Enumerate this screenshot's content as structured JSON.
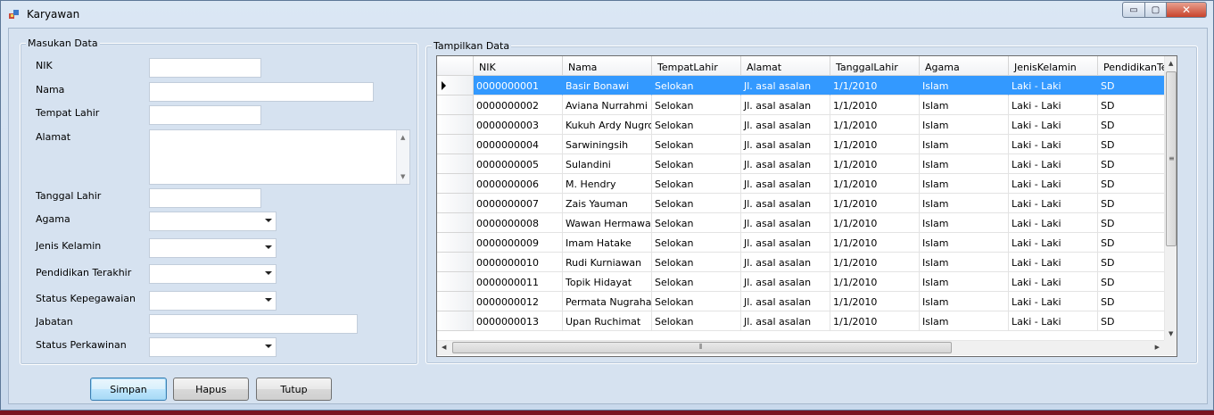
{
  "window": {
    "title": "Karyawan",
    "controls": {
      "minimize": "▭",
      "maximize": "▢",
      "close": "✕"
    }
  },
  "input_group": {
    "title": "Masukan Data",
    "fields": {
      "nik": {
        "label": "NIK",
        "value": ""
      },
      "nama": {
        "label": "Nama",
        "value": ""
      },
      "tempat_lahir": {
        "label": "Tempat Lahir",
        "value": ""
      },
      "alamat": {
        "label": "Alamat",
        "value": ""
      },
      "tanggal_lahir": {
        "label": "Tanggal Lahir",
        "value": ""
      },
      "agama": {
        "label": "Agama",
        "value": ""
      },
      "jenis_kelamin": {
        "label": "Jenis Kelamin",
        "value": ""
      },
      "pendidikan": {
        "label": "Pendidikan Terakhir",
        "value": ""
      },
      "status_kepegawaian": {
        "label": "Status Kepegawaian",
        "value": ""
      },
      "jabatan": {
        "label": "Jabatan",
        "value": ""
      },
      "status_perkawinan": {
        "label": "Status Perkawinan",
        "value": ""
      }
    }
  },
  "buttons": {
    "save": "Simpan",
    "delete": "Hapus",
    "close": "Tutup"
  },
  "display_group": {
    "title": "Tampilkan Data",
    "columns": [
      "NIK",
      "Nama",
      "TempatLahir",
      "Alamat",
      "TanggalLahir",
      "Agama",
      "JenisKelamin",
      "PendidikanTerakhir"
    ],
    "rows": [
      [
        "0000000001",
        "Basir Bonawi",
        "Selokan",
        "Jl. asal asalan",
        "1/1/2010",
        "Islam",
        "Laki - Laki",
        "SD"
      ],
      [
        "0000000002",
        "Aviana Nurrahmi",
        "Selokan",
        "Jl. asal asalan",
        "1/1/2010",
        "Islam",
        "Laki - Laki",
        "SD"
      ],
      [
        "0000000003",
        "Kukuh Ardy Nugroho",
        "Selokan",
        "Jl. asal asalan",
        "1/1/2010",
        "Islam",
        "Laki - Laki",
        "SD"
      ],
      [
        "0000000004",
        "Sarwiningsih",
        "Selokan",
        "Jl. asal asalan",
        "1/1/2010",
        "Islam",
        "Laki - Laki",
        "SD"
      ],
      [
        "0000000005",
        "Sulandini",
        "Selokan",
        "Jl. asal asalan",
        "1/1/2010",
        "Islam",
        "Laki - Laki",
        "SD"
      ],
      [
        "0000000006",
        "M. Hendry",
        "Selokan",
        "Jl. asal asalan",
        "1/1/2010",
        "Islam",
        "Laki - Laki",
        "SD"
      ],
      [
        "0000000007",
        "Zais Yauman",
        "Selokan",
        "Jl. asal asalan",
        "1/1/2010",
        "Islam",
        "Laki - Laki",
        "SD"
      ],
      [
        "0000000008",
        "Wawan Hermawan",
        "Selokan",
        "Jl. asal asalan",
        "1/1/2010",
        "Islam",
        "Laki - Laki",
        "SD"
      ],
      [
        "0000000009",
        "Imam Hatake",
        "Selokan",
        "Jl. asal asalan",
        "1/1/2010",
        "Islam",
        "Laki - Laki",
        "SD"
      ],
      [
        "0000000010",
        "Rudi Kurniawan",
        "Selokan",
        "Jl. asal asalan",
        "1/1/2010",
        "Islam",
        "Laki - Laki",
        "SD"
      ],
      [
        "0000000011",
        "Topik Hidayat",
        "Selokan",
        "Jl. asal asalan",
        "1/1/2010",
        "Islam",
        "Laki - Laki",
        "SD"
      ],
      [
        "0000000012",
        "Permata Nugraha",
        "Selokan",
        "Jl. asal asalan",
        "1/1/2010",
        "Islam",
        "Laki - Laki",
        "SD"
      ],
      [
        "0000000013",
        "Upan Ruchimat",
        "Selokan",
        "Jl. asal asalan",
        "1/1/2010",
        "Islam",
        "Laki - Laki",
        "SD"
      ]
    ],
    "selected_row": 0
  },
  "colors": {
    "selection": "#3399ff",
    "window_bg": "#d6e2f0",
    "taskbar": "#7a1420"
  }
}
